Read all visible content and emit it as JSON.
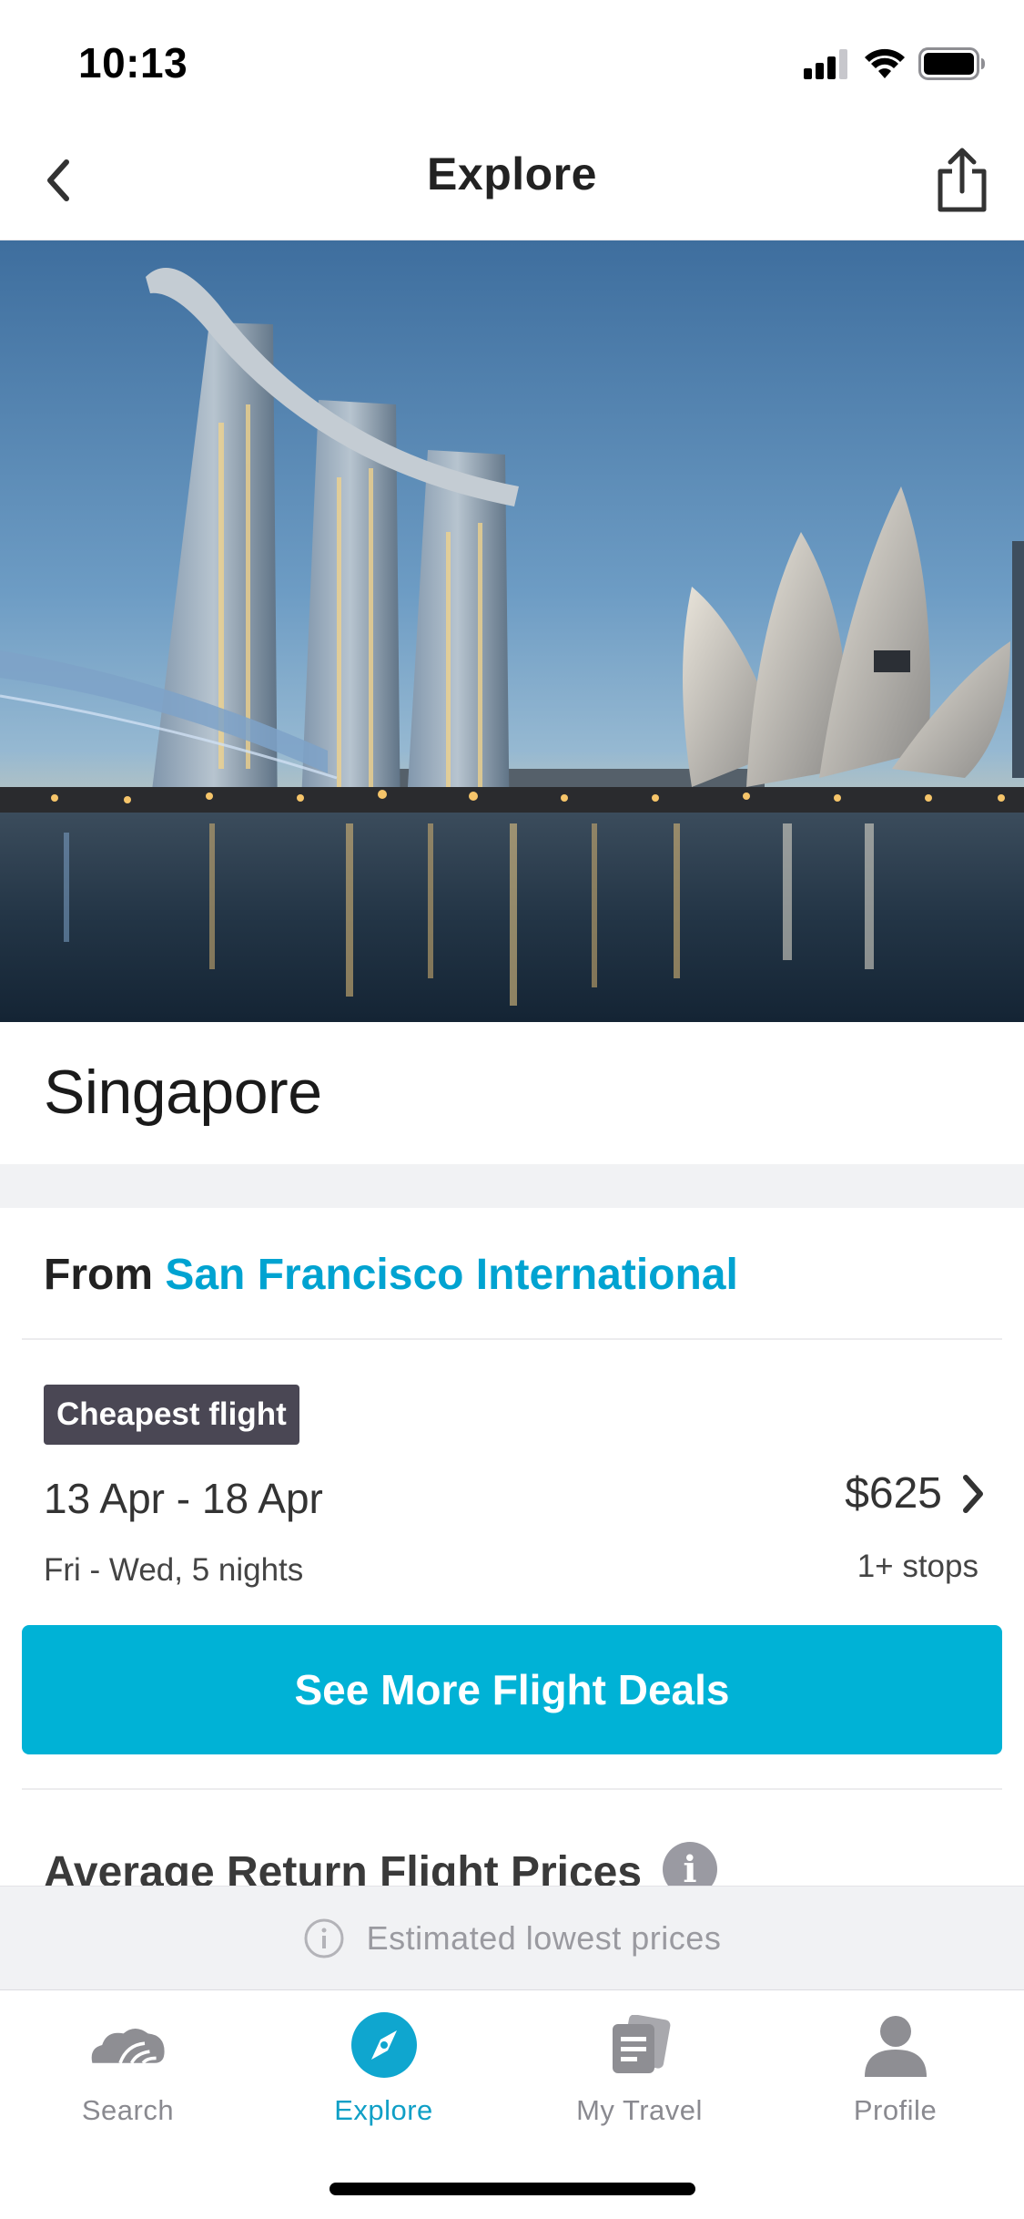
{
  "status_bar": {
    "time": "10:13"
  },
  "nav": {
    "title": "Explore",
    "back_icon": "chevron-left-icon",
    "share_icon": "share-icon"
  },
  "hero": {
    "alt": "Singapore skyline at dusk"
  },
  "destination": {
    "name": "Singapore"
  },
  "origin": {
    "prefix": "From",
    "airport": "San Francisco International"
  },
  "cheapest": {
    "badge": "Cheapest flight",
    "dates": "13 Apr - 18 Apr",
    "days": "Fri - Wed, 5 nights",
    "price": "$625",
    "stops": "1+ stops"
  },
  "cta": {
    "label": "See More Flight Deals"
  },
  "average": {
    "title": "Average Return Flight Prices",
    "info_glyph": "i"
  },
  "estimate": {
    "text": "Estimated lowest prices"
  },
  "tabs": [
    {
      "label": "Search",
      "icon": "skyscanner-cloud-icon",
      "active": false
    },
    {
      "label": "Explore",
      "icon": "compass-icon",
      "active": true
    },
    {
      "label": "My Travel",
      "icon": "documents-icon",
      "active": false
    },
    {
      "label": "Profile",
      "icon": "person-icon",
      "active": false
    }
  ],
  "colors": {
    "accent": "#00b2d6",
    "link": "#00a3d1",
    "badge": "#4a4754"
  }
}
